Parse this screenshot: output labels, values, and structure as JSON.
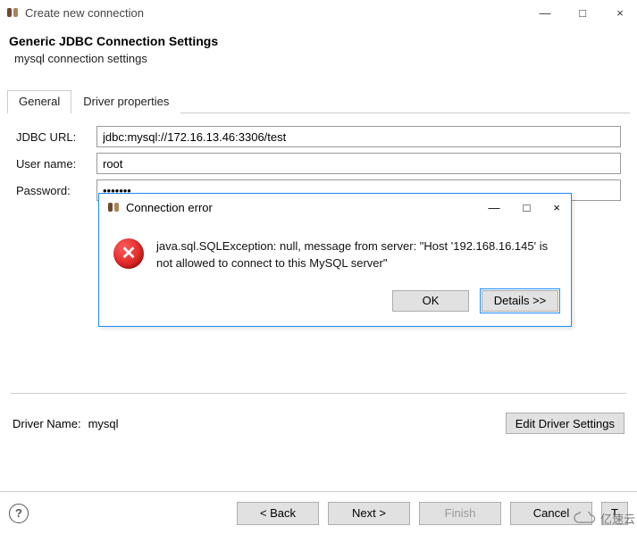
{
  "window": {
    "title": "Create new connection",
    "controls": {
      "min": "—",
      "max": "□",
      "close": "×"
    }
  },
  "header": {
    "title": "Generic JDBC Connection Settings",
    "subtitle": "mysql connection settings"
  },
  "tabs": {
    "general": "General",
    "driver_props": "Driver properties"
  },
  "form": {
    "jdbc_url_label": "JDBC URL:",
    "jdbc_url_value": "jdbc:mysql://172.16.13.46:3306/test",
    "username_label": "User name:",
    "username_value": "root",
    "password_label": "Password:",
    "password_value": "•••••••"
  },
  "driver": {
    "label": "Driver Name:",
    "value": "mysql",
    "button": "Edit Driver Settings"
  },
  "wizard": {
    "back": "< Back",
    "next": "Next >",
    "finish": "Finish",
    "cancel": "Cancel",
    "test": "T"
  },
  "watermark": "亿速云",
  "modal": {
    "title": "Connection error",
    "controls": {
      "min": "—",
      "max": "□",
      "close": "×"
    },
    "message": "java.sql.SQLException: null,  message from server: \"Host '192.168.16.145' is not allowed to connect to this MySQL server\"",
    "ok": "OK",
    "details": "Details >>"
  }
}
